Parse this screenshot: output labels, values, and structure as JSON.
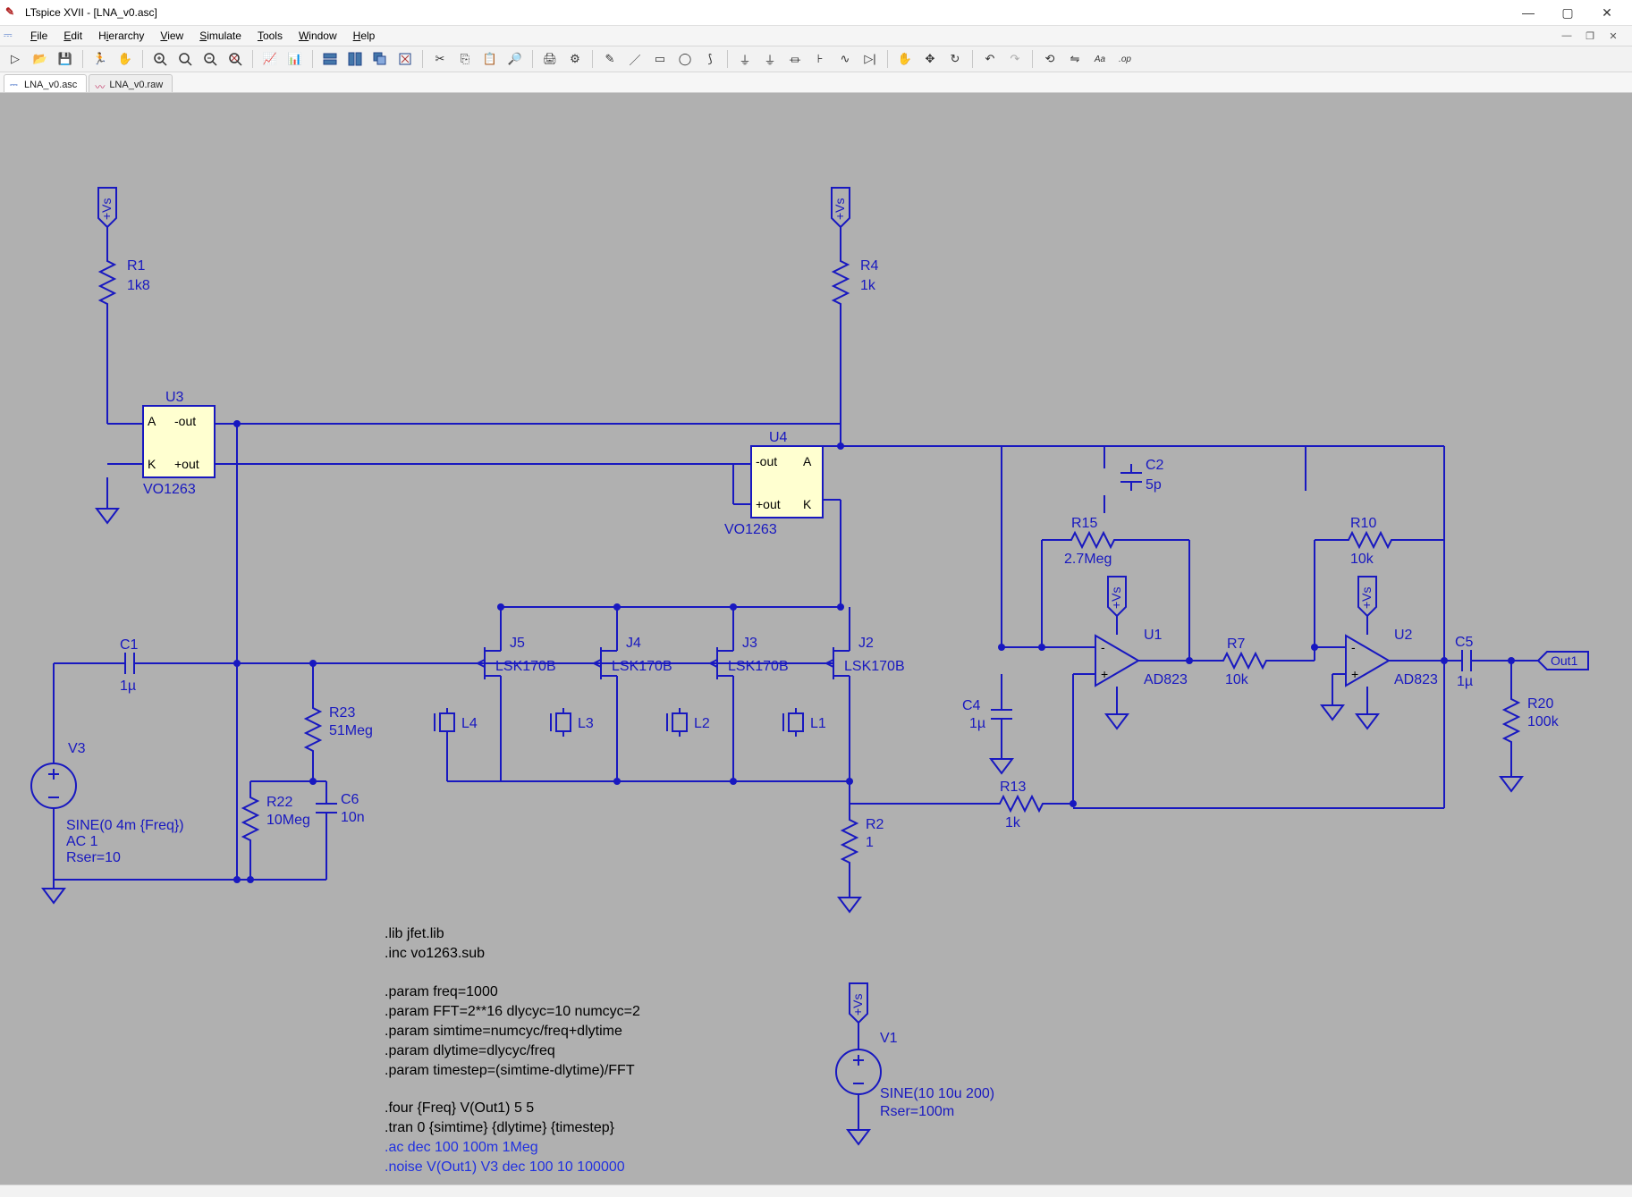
{
  "window": {
    "title": "LTspice XVII - [LNA_v0.asc]"
  },
  "menu": {
    "file": "File",
    "edit": "Edit",
    "hierarchy": "Hierarchy",
    "view": "View",
    "simulate": "Simulate",
    "tools": "Tools",
    "window": "Window",
    "help": "Help"
  },
  "tabs": [
    {
      "label": "LNA_v0.asc",
      "type": "asc",
      "active": true
    },
    {
      "label": "LNA_v0.raw",
      "type": "raw",
      "active": false
    }
  ],
  "toolbar_icons": [
    "new",
    "open",
    "save",
    "sep",
    "run",
    "pause",
    "sep",
    "zoom-in",
    "pan",
    "zoom-out",
    "zoom-fit",
    "sep",
    "pick",
    "autorange",
    "sep",
    "tile-horz",
    "tile-vert",
    "cascade",
    "close-win",
    "sep",
    "cut",
    "copy",
    "paste",
    "find",
    "sep",
    "print",
    "setup",
    "sep",
    "draw-wire",
    "draw-line",
    "draw-rect",
    "draw-circle",
    "draw-arc",
    "sep",
    "net-name",
    "ground",
    "resistor",
    "capacitor",
    "inductor",
    "diode",
    "sep",
    "component",
    "move",
    "drag",
    "sep",
    "undo",
    "redo",
    "sep",
    "rotate",
    "mirror",
    "text",
    "spice-dir",
    "op-label"
  ],
  "netlabels": {
    "vs": "+Vs",
    "out1": "Out1"
  },
  "components": {
    "R1": {
      "name": "R1",
      "value": "1k8"
    },
    "R4": {
      "name": "R4",
      "value": "1k"
    },
    "U3": {
      "name": "U3",
      "value": "VO1263",
      "pins": {
        "a": "A",
        "k": "K",
        "mout": "-out",
        "pout": "+out"
      }
    },
    "U4": {
      "name": "U4",
      "value": "VO1263",
      "pins": {
        "a": "A",
        "k": "K",
        "mout": "-out",
        "pout": "+out"
      }
    },
    "C1": {
      "name": "C1",
      "value": "1µ"
    },
    "C6": {
      "name": "C6",
      "value": "10n"
    },
    "C2": {
      "name": "C2",
      "value": "5p"
    },
    "C4": {
      "name": "C4",
      "value": "1µ"
    },
    "C5": {
      "name": "C5",
      "value": "1µ"
    },
    "R23": {
      "name": "R23",
      "value": "51Meg"
    },
    "R22": {
      "name": "R22",
      "value": "10Meg"
    },
    "R2": {
      "name": "R2",
      "value": "1"
    },
    "R13": {
      "name": "R13",
      "value": "1k"
    },
    "R15": {
      "name": "R15",
      "value": "2.7Meg"
    },
    "R7": {
      "name": "R7",
      "value": "10k"
    },
    "R10": {
      "name": "R10",
      "value": "10k"
    },
    "R20": {
      "name": "R20",
      "value": "100k"
    },
    "J5": {
      "name": "J5",
      "value": "LSK170B"
    },
    "J4": {
      "name": "J4",
      "value": "LSK170B"
    },
    "J3": {
      "name": "J3",
      "value": "LSK170B"
    },
    "J2": {
      "name": "J2",
      "value": "LSK170B"
    },
    "L4": {
      "name": "L4"
    },
    "L3": {
      "name": "L3"
    },
    "L2": {
      "name": "L2"
    },
    "L1": {
      "name": "L1"
    },
    "U1": {
      "name": "U1",
      "value": "AD823"
    },
    "U2": {
      "name": "U2",
      "value": "AD823"
    },
    "V3": {
      "name": "V3",
      "line1": "SINE(0 4m {Freq})",
      "line2": "AC 1",
      "line3": "Rser=10"
    },
    "V1": {
      "name": "V1",
      "line1": "SINE(10 10u 200)",
      "line2": "Rser=100m"
    }
  },
  "directives": [
    {
      "text": ".lib jfet.lib",
      "disabled": false
    },
    {
      "text": ".inc vo1263.sub",
      "disabled": false
    },
    {
      "text": "",
      "disabled": false
    },
    {
      "text": ".param freq=1000",
      "disabled": false
    },
    {
      "text": ".param FFT=2**16 dlycyc=10 numcyc=2",
      "disabled": false
    },
    {
      "text": ".param simtime=numcyc/freq+dlytime",
      "disabled": false
    },
    {
      "text": ".param dlytime=dlycyc/freq",
      "disabled": false
    },
    {
      "text": ".param timestep=(simtime-dlytime)/FFT",
      "disabled": false
    },
    {
      "text": "",
      "disabled": false
    },
    {
      "text": ".four {Freq} V(Out1) 5 5",
      "disabled": false
    },
    {
      "text": ".tran 0 {simtime} {dlytime} {timestep}",
      "disabled": false
    },
    {
      "text": ".ac dec 100 100m 1Meg",
      "disabled": true
    },
    {
      "text": ".noise V(Out1) V3 dec 100 10 100000",
      "disabled": true
    }
  ],
  "status": ""
}
